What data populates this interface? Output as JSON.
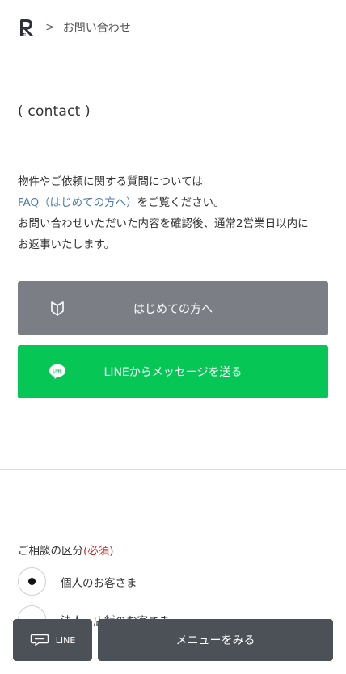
{
  "breadcrumb": {
    "logo_icon": "r-logo-icon",
    "separator": ">",
    "current": "お問い合わせ"
  },
  "heading": "( contact )",
  "intro": {
    "line1": "物件やご依頼に関する質問については",
    "faq_link": "FAQ（はじめての方へ）",
    "line2_rest": "をご覧ください。",
    "line3": "お問い合わせいただいた内容を確認後、通常2営業日以内に",
    "line4": "お返事いたします。"
  },
  "buttons": {
    "first_time": {
      "label": "はじめての方へ",
      "icon": "beginner-mark-icon"
    },
    "line": {
      "label": "LINEからメッセージを送る",
      "icon": "line-icon"
    }
  },
  "form": {
    "consult_label": "ご相談の区分",
    "required_label": "(必須)",
    "options": [
      {
        "label": "個人のお客さま",
        "selected": true
      },
      {
        "label": "法人・店舗のお客さま",
        "selected": false
      }
    ]
  },
  "bottom_bar": {
    "line_label": "LINE",
    "line_icon": "chat-icon",
    "menu_label": "メニューをみる"
  },
  "colors": {
    "line_green": "#06c755",
    "first_button": "#7b7f85",
    "bottom_bar": "#4c5158",
    "link": "#4b7bab",
    "required": "#c9302c"
  }
}
